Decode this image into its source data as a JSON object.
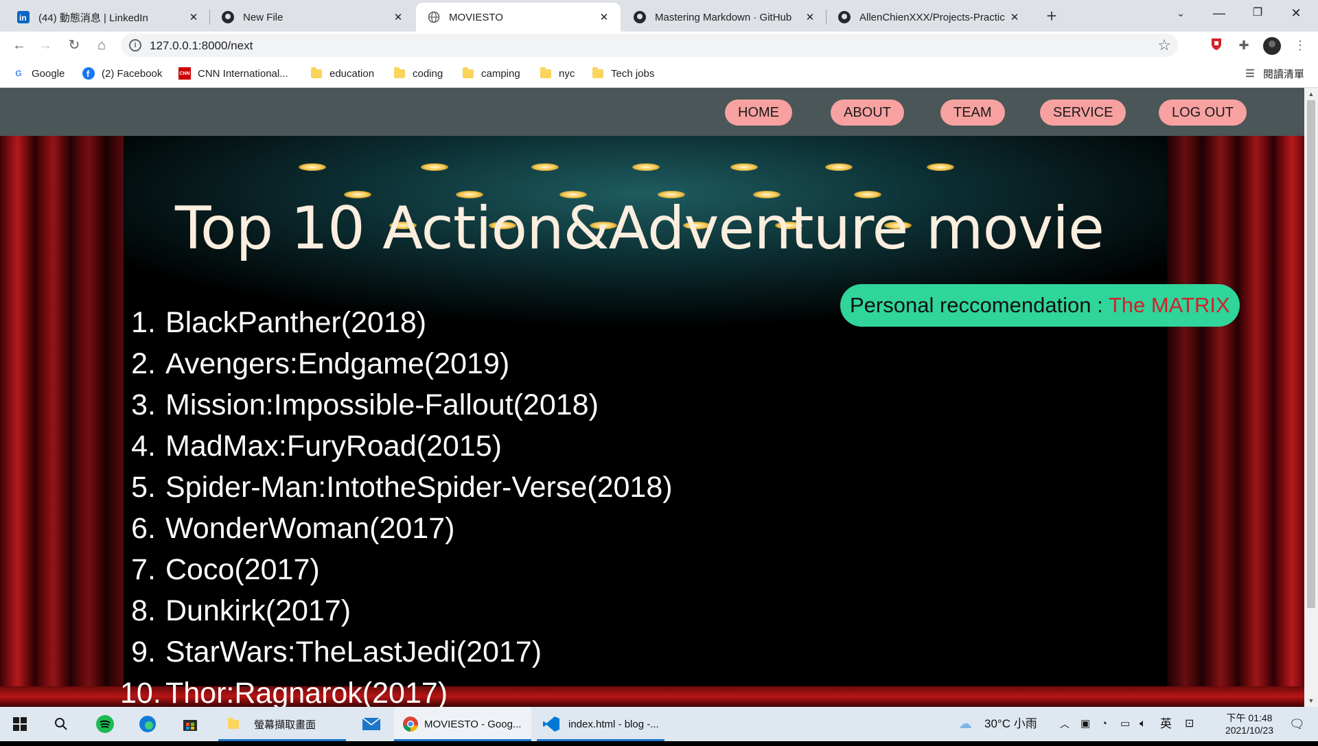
{
  "browser": {
    "tabs": [
      {
        "title": "(44) 動態消息 | LinkedIn",
        "icon": "linkedin-icon"
      },
      {
        "title": "New File",
        "icon": "github-icon"
      },
      {
        "title": "MOVIESTO",
        "icon": "globe-icon"
      },
      {
        "title": "Mastering Markdown · GitHub",
        "icon": "github-icon"
      },
      {
        "title": "AllenChienXXX/Projects-Practic",
        "icon": "github-icon"
      }
    ],
    "url": "127.0.0.1:8000/next",
    "bookmarks": [
      {
        "label": "Google",
        "icon": "google-icon"
      },
      {
        "label": "(2) Facebook",
        "icon": "facebook-icon"
      },
      {
        "label": "CNN International...",
        "icon": "cnn-icon"
      },
      {
        "label": "education",
        "icon": "folder-icon"
      },
      {
        "label": "coding",
        "icon": "folder-icon"
      },
      {
        "label": "camping",
        "icon": "folder-icon"
      },
      {
        "label": "nyc",
        "icon": "folder-icon"
      },
      {
        "label": "Tech jobs",
        "icon": "folder-icon"
      }
    ],
    "reading_list": "閱讀清單"
  },
  "page": {
    "nav": [
      "HOME",
      "ABOUT",
      "TEAM",
      "SERVICE",
      "LOG OUT"
    ],
    "title": "Top 10 Action&Adventure movie",
    "recommendation": {
      "label": "Personal reccomendation : ",
      "movie": "The MATRIX"
    },
    "movies": [
      {
        "num": "1.",
        "title": "BlackPanther(2018)"
      },
      {
        "num": "2.",
        "title": "Avengers:Endgame(2019)"
      },
      {
        "num": "3.",
        "title": "Mission:Impossible-Fallout(2018)"
      },
      {
        "num": "4.",
        "title": "MadMax:FuryRoad(2015)"
      },
      {
        "num": "5.",
        "title": "Spider-Man:IntotheSpider-Verse(2018)"
      },
      {
        "num": "6.",
        "title": "WonderWoman(2017)"
      },
      {
        "num": "7.",
        "title": "Coco(2017)"
      },
      {
        "num": "8.",
        "title": "Dunkirk(2017)"
      },
      {
        "num": "9.",
        "title": "StarWars:TheLastJedi(2017)"
      },
      {
        "num": "10.",
        "title": "Thor:Ragnarok(2017)"
      }
    ],
    "colors": {
      "navbar": "#4a5657",
      "nav_button": "#f8a1a1",
      "recommendation_bg": "#2fd59a",
      "recommendation_highlight": "#d1212b"
    }
  },
  "taskbar": {
    "apps": [
      {
        "label": "螢幕擷取畫面",
        "icon": "folder-icon"
      },
      {
        "label": "MOVIESTO - Goog...",
        "icon": "chrome-icon"
      },
      {
        "label": "index.html - blog -...",
        "icon": "vscode-icon"
      }
    ],
    "weather": "30°C 小雨",
    "ime": "英",
    "time": "下午 01:48",
    "date": "2021/10/23"
  }
}
